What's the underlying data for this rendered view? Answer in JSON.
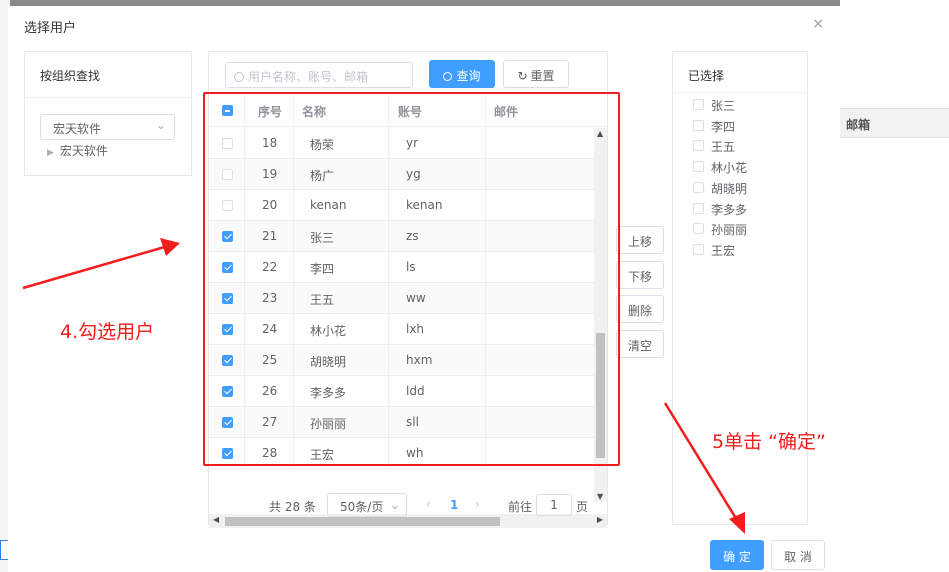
{
  "dialog": {
    "title": "选择用户",
    "close_glyph": "×"
  },
  "left_panel": {
    "header": "按组织查找",
    "org_select_value": "宏天软件",
    "tree_node": "宏天软件"
  },
  "search": {
    "placeholder": "用户名称、账号、邮箱",
    "query_label": "查询",
    "reset_label": "重置"
  },
  "table": {
    "headers": {
      "index": "序号",
      "name": "名称",
      "account": "账号",
      "email": "邮件"
    },
    "rows": [
      {
        "index": "18",
        "name": "杨荣",
        "account": "yr",
        "checked": false
      },
      {
        "index": "19",
        "name": "杨广",
        "account": "yg",
        "checked": false
      },
      {
        "index": "20",
        "name": "kenan",
        "account": "kenan",
        "checked": false
      },
      {
        "index": "21",
        "name": "张三",
        "account": "zs",
        "checked": true
      },
      {
        "index": "22",
        "name": "李四",
        "account": "ls",
        "checked": true
      },
      {
        "index": "23",
        "name": "王五",
        "account": "ww",
        "checked": true
      },
      {
        "index": "24",
        "name": "林小花",
        "account": "lxh",
        "checked": true
      },
      {
        "index": "25",
        "name": "胡晓明",
        "account": "hxm",
        "checked": true
      },
      {
        "index": "26",
        "name": "李多多",
        "account": "ldd",
        "checked": true
      },
      {
        "index": "27",
        "name": "孙丽丽",
        "account": "sll",
        "checked": true
      },
      {
        "index": "28",
        "name": "王宏",
        "account": "wh",
        "checked": true
      }
    ]
  },
  "pagination": {
    "total": "共 28 条",
    "page_size": "50条/页",
    "current_page": "1",
    "goto_label": "前往",
    "goto_value": "1",
    "page_suffix": "页"
  },
  "ops": {
    "move_up": "上移",
    "move_down": "下移",
    "delete": "删除",
    "clear": "清空"
  },
  "selected_panel": {
    "header": "已选择",
    "items": [
      "张三",
      "李四",
      "王五",
      "林小花",
      "胡晓明",
      "李多多",
      "孙丽丽",
      "王宏"
    ]
  },
  "footer": {
    "confirm": "确 定",
    "cancel": "取 消"
  },
  "background": {
    "column_header": "邮箱"
  },
  "annotations": {
    "step4": "4.勾选用户",
    "step5": "5单击 “确定”"
  },
  "colors": {
    "primary": "#409eff",
    "annotation_red": "#f31d1d"
  }
}
